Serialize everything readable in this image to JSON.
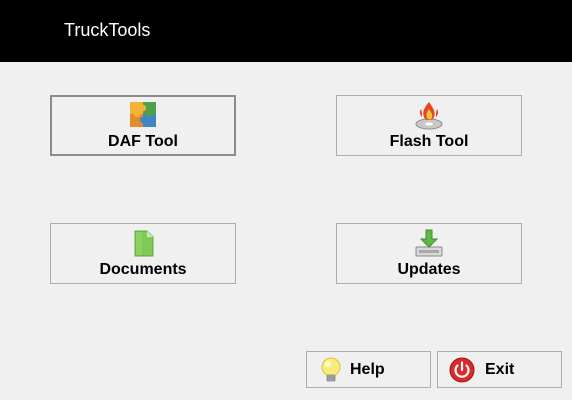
{
  "window": {
    "title": "TruckTools"
  },
  "tiles": [
    {
      "label": "DAF Tool",
      "icon": "puzzle-icon"
    },
    {
      "label": "Flash Tool",
      "icon": "fire-disc-icon"
    },
    {
      "label": "Documents",
      "icon": "document-icon"
    },
    {
      "label": "Updates",
      "icon": "download-icon"
    }
  ],
  "footer": {
    "help_label": "Help",
    "help_icon": "lightbulb-icon",
    "exit_label": "Exit",
    "exit_icon": "power-icon"
  },
  "colors": {
    "titlebar": "#000000",
    "background": "#f0f0f0",
    "button_border": "#adadad"
  }
}
